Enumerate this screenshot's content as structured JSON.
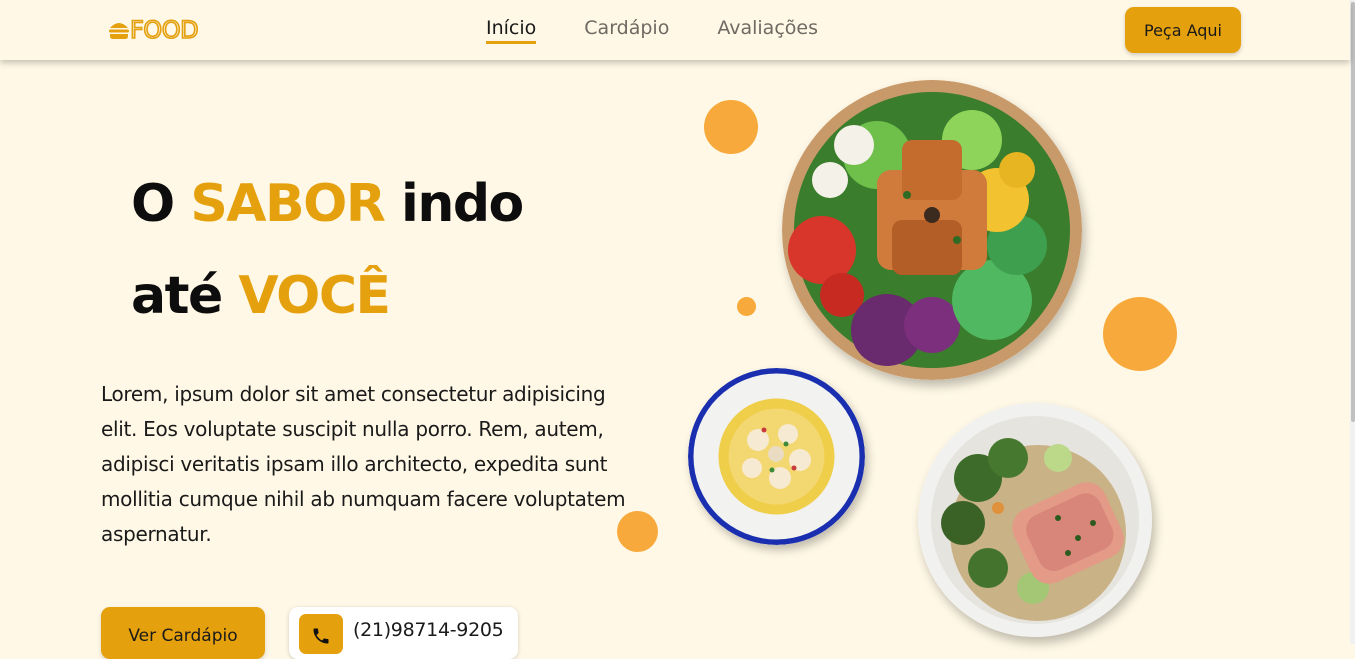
{
  "brand": {
    "logo_text": "FOOD",
    "logo_icon": "burger-icon"
  },
  "nav": {
    "links": [
      {
        "label": "Início",
        "active": true
      },
      {
        "label": "Cardápio",
        "active": false
      },
      {
        "label": "Avaliações",
        "active": false
      }
    ],
    "order_button": "Peça Aqui"
  },
  "hero": {
    "title": {
      "line1_part1": "O ",
      "line1_accent": "SABOR",
      "line1_part2": " indo",
      "line2_part1": "até ",
      "line2_accent": "VOCÊ"
    },
    "description": "Lorem, ipsum dolor sit amet consectetur adipisicing elit. Eos voluptate suscipit nulla porro. Rem, autem, adipisci veritatis ipsam illo architecto, expedita sunt mollitia cumque nihil ab numquam facere voluptatem aspernatur.",
    "menu_button": "Ver Cardápio",
    "phone": {
      "icon": "phone-icon",
      "number": "(21)98714-9205"
    }
  },
  "images": [
    {
      "name": "salad-bowl-image"
    },
    {
      "name": "carpaccio-plate-image"
    },
    {
      "name": "salmon-broccoli-plate-image"
    }
  ],
  "colors": {
    "accent": "#e5a00d",
    "background": "#fff8e6",
    "decor_dot": "#f8a93b",
    "text": "#0d0d0d"
  }
}
